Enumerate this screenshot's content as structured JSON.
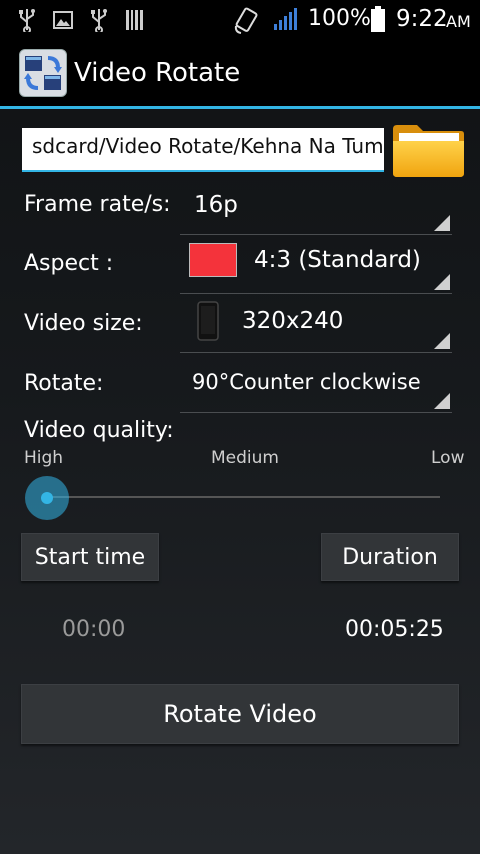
{
  "status_bar": {
    "battery": "100%",
    "time": "9:22",
    "ampm": "AM"
  },
  "action_bar": {
    "title": "Video Rotate"
  },
  "path_field": {
    "value": "sdcard/Video Rotate/Kehna Na Tum"
  },
  "settings": {
    "frame_rate_label": "Frame rate/s:",
    "frame_rate_value": "16p",
    "aspect_label": "Aspect :",
    "aspect_value": "4:3 (Standard)",
    "aspect_color": "#f4333b",
    "video_size_label": "Video size:",
    "video_size_value": "320x240",
    "rotate_label": "Rotate:",
    "rotate_value": "90°Counter clockwise"
  },
  "quality": {
    "label": "Video quality:",
    "high": "High",
    "medium": "Medium",
    "low": "Low",
    "selected": "High"
  },
  "time_controls": {
    "start_button": "Start time",
    "duration_button": "Duration",
    "start_value": "00:00",
    "duration_value": "00:05:25"
  },
  "rotate_button": "Rotate Video",
  "colors": {
    "accent": "#33b5e5",
    "dim_text": "#9a9a9a"
  },
  "icons": [
    "usb-icon",
    "image-icon",
    "usb-icon",
    "barcode-icon",
    "rotate-phone-icon",
    "signal-icon",
    "battery-icon",
    "app-logo-icon",
    "folder-icon",
    "phone-icon"
  ]
}
